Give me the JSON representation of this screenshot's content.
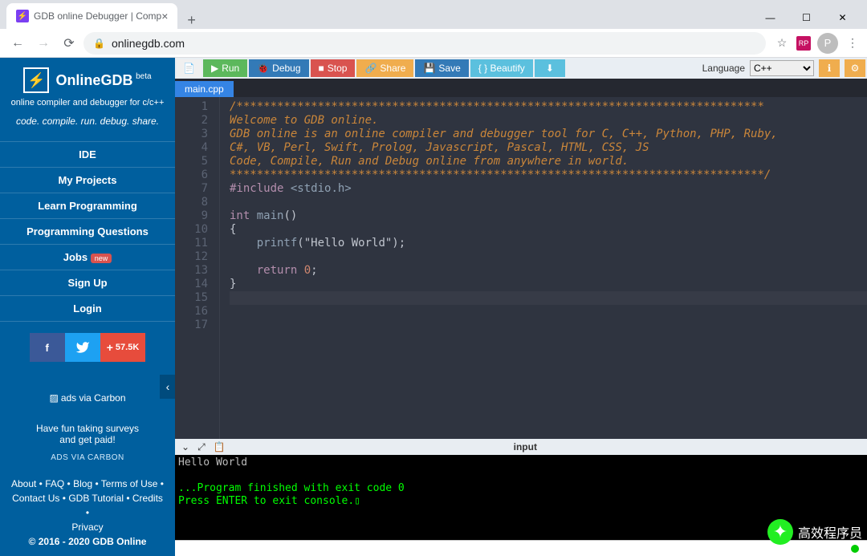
{
  "browser": {
    "tab_title": "GDB online Debugger | Comp",
    "url": "onlinegdb.com",
    "avatar_letter": "P"
  },
  "sidebar": {
    "brand": "OnlineGDB",
    "beta": "beta",
    "subtitle": "online compiler and debugger for c/c++",
    "tagline": "code. compile. run. debug. share.",
    "items": [
      {
        "label": "IDE"
      },
      {
        "label": "My Projects"
      },
      {
        "label": "Learn Programming"
      },
      {
        "label": "Programming Questions"
      },
      {
        "label": "Jobs",
        "badge": "new"
      },
      {
        "label": "Sign Up"
      },
      {
        "label": "Login"
      }
    ],
    "share_count": "57.5K",
    "ads": {
      "alt": "ads via Carbon",
      "line1": "Have fun taking surveys",
      "line2": "and get paid!",
      "via": "ADS VIA CARBON"
    },
    "footer": [
      "About",
      "FAQ",
      "Blog",
      "Terms of Use",
      "Contact Us",
      "GDB Tutorial",
      "Credits",
      "Privacy"
    ],
    "copyright": "© 2016 - 2020 GDB Online"
  },
  "toolbar": {
    "run": "Run",
    "debug": "Debug",
    "stop": "Stop",
    "share": "Share",
    "save": "Save",
    "beautify": "{ } Beautify",
    "language_label": "Language",
    "language_value": "C++"
  },
  "file_tab": "main.cpp",
  "code_lines": [
    "/******************************************************************************",
    "",
    "Welcome to GDB online.",
    "GDB online is an online compiler and debugger tool for C, C++, Python, PHP, Ruby,",
    "C#, VB, Perl, Swift, Prolog, Javascript, Pascal, HTML, CSS, JS",
    "Code, Compile, Run and Debug online from anywhere in world.",
    "",
    "*******************************************************************************/",
    "#include <stdio.h>",
    "",
    "int main()",
    "{",
    "    printf(\"Hello World\");",
    "",
    "    return 0;",
    "}",
    ""
  ],
  "panel_title": "input",
  "console": {
    "out": "Hello World",
    "done": "...Program finished with exit code 0",
    "prompt": "Press ENTER to exit console."
  },
  "watermark": "高效程序员"
}
